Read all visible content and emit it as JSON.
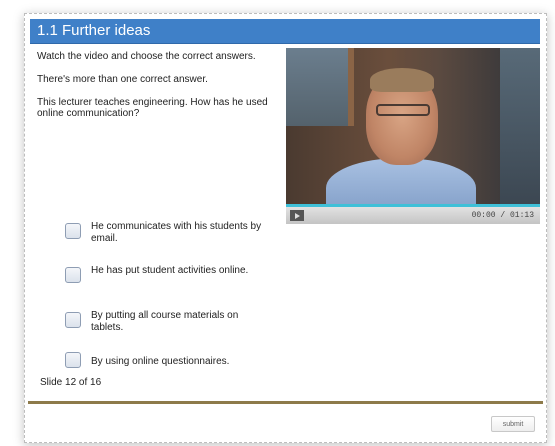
{
  "header": {
    "title": "1.1 Further ideas"
  },
  "instructions": {
    "line1": "Watch the video and choose the correct answers.",
    "line2": "There's more than one correct answer.",
    "question": "This lecturer teaches engineering. How has he used online communication?"
  },
  "video": {
    "time": "00:00 / 01:13",
    "progress_fraction": 0
  },
  "options": [
    {
      "label": "He communicates with his students by email.",
      "checked": false
    },
    {
      "label": "He has put student activities online.",
      "checked": false
    },
    {
      "label": "By putting all course materials on tablets.",
      "checked": false
    },
    {
      "label": "By using online questionnaires.",
      "checked": false
    }
  ],
  "footer": {
    "slide_counter": "Slide 12 of 16",
    "submit_label": "submit"
  },
  "colors": {
    "title_bar": "#3f80c8",
    "video_progress": "#3ec0d8",
    "divider": "#8d7a4a"
  },
  "icons": {
    "play": "play-icon"
  }
}
